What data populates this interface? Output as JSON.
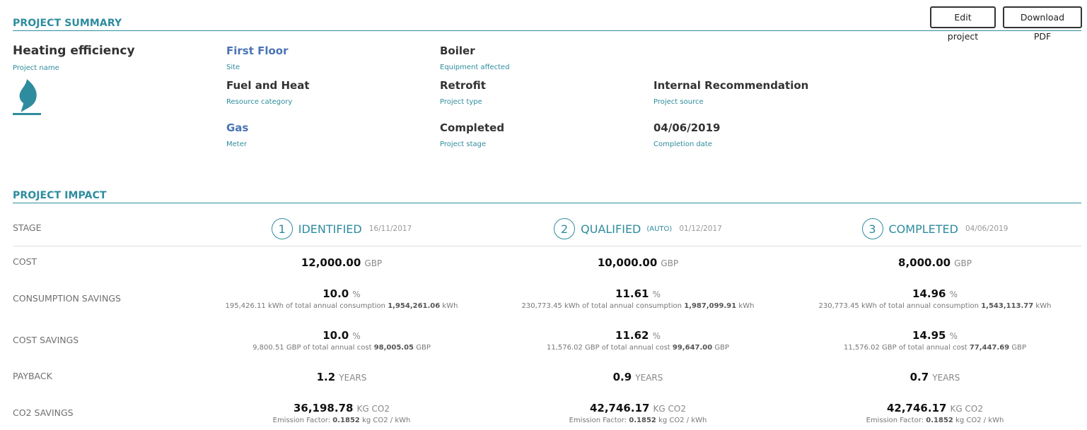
{
  "header": {
    "summary_title": "PROJECT SUMMARY",
    "edit_label": "Edit project",
    "download_label": "Download PDF"
  },
  "summary": {
    "project_name": {
      "value": "Heating efficiency",
      "label": "Project name"
    },
    "site": {
      "value": "First Floor",
      "label": "Site"
    },
    "equipment": {
      "value": "Boiler",
      "label": "Equipment affected"
    },
    "resource": {
      "value": "Fuel and Heat",
      "label": "Resource category"
    },
    "project_type": {
      "value": "Retrofit",
      "label": "Project type"
    },
    "source": {
      "value": "Internal Recommendation",
      "label": "Project source"
    },
    "meter": {
      "value": "Gas",
      "label": "Meter"
    },
    "stage": {
      "value": "Completed",
      "label": "Project stage"
    },
    "completion": {
      "value": "04/06/2019",
      "label": "Completion date"
    },
    "icon": "flame-icon",
    "accent_color": "#2e8c9e"
  },
  "impact": {
    "title": "PROJECT IMPACT",
    "row_labels": {
      "stage": "STAGE",
      "cost": "COST",
      "consumption": "CONSUMPTION SAVINGS",
      "cost_savings": "COST SAVINGS",
      "payback": "PAYBACK",
      "co2": "CO2 SAVINGS"
    },
    "stages": [
      {
        "num": "1",
        "name": "IDENTIFIED",
        "auto": "",
        "date": "16/11/2017",
        "cost": "12,000.00",
        "cost_unit": "GBP",
        "cons_pct": "10.0",
        "cons_unit": "%",
        "cons_a": "195,426.11",
        "cons_mid": "kWh of total annual consumption",
        "cons_b": "1,954,261.06",
        "cons_unit2": "kWh",
        "cs_pct": "10.0",
        "cs_unit": "%",
        "cs_a": "9,800.51",
        "cs_mid": "GBP of total annual cost",
        "cs_b": "98,005.05",
        "cs_unit2": "GBP",
        "payback": "1.2",
        "payback_unit": "YEARS",
        "co2": "36,198.78",
        "co2_unit": "KG CO2",
        "ef_pre": "Emission Factor:",
        "ef_val": "0.1852",
        "ef_unit": "kg CO2 / kWh"
      },
      {
        "num": "2",
        "name": "QUALIFIED",
        "auto": "(AUTO)",
        "date": "01/12/2017",
        "cost": "10,000.00",
        "cost_unit": "GBP",
        "cons_pct": "11.61",
        "cons_unit": "%",
        "cons_a": "230,773.45",
        "cons_mid": "kWh of total annual consumption",
        "cons_b": "1,987,099.91",
        "cons_unit2": "kWh",
        "cs_pct": "11.62",
        "cs_unit": "%",
        "cs_a": "11,576.02",
        "cs_mid": "GBP of total annual cost",
        "cs_b": "99,647.00",
        "cs_unit2": "GBP",
        "payback": "0.9",
        "payback_unit": "YEARS",
        "co2": "42,746.17",
        "co2_unit": "KG CO2",
        "ef_pre": "Emission Factor:",
        "ef_val": "0.1852",
        "ef_unit": "kg CO2 / kWh"
      },
      {
        "num": "3",
        "name": "COMPLETED",
        "auto": "",
        "date": "04/06/2019",
        "cost": "8,000.00",
        "cost_unit": "GBP",
        "cons_pct": "14.96",
        "cons_unit": "%",
        "cons_a": "230,773.45",
        "cons_mid": "kWh of total annual consumption",
        "cons_b": "1,543,113.77",
        "cons_unit2": "kWh",
        "cs_pct": "14.95",
        "cs_unit": "%",
        "cs_a": "11,576.02",
        "cs_mid": "GBP of total annual cost",
        "cs_b": "77,447.69",
        "cs_unit2": "GBP",
        "payback": "0.7",
        "payback_unit": "YEARS",
        "co2": "42,746.17",
        "co2_unit": "KG CO2",
        "ef_pre": "Emission Factor:",
        "ef_val": "0.1852",
        "ef_unit": "kg CO2 / kWh"
      }
    ]
  }
}
